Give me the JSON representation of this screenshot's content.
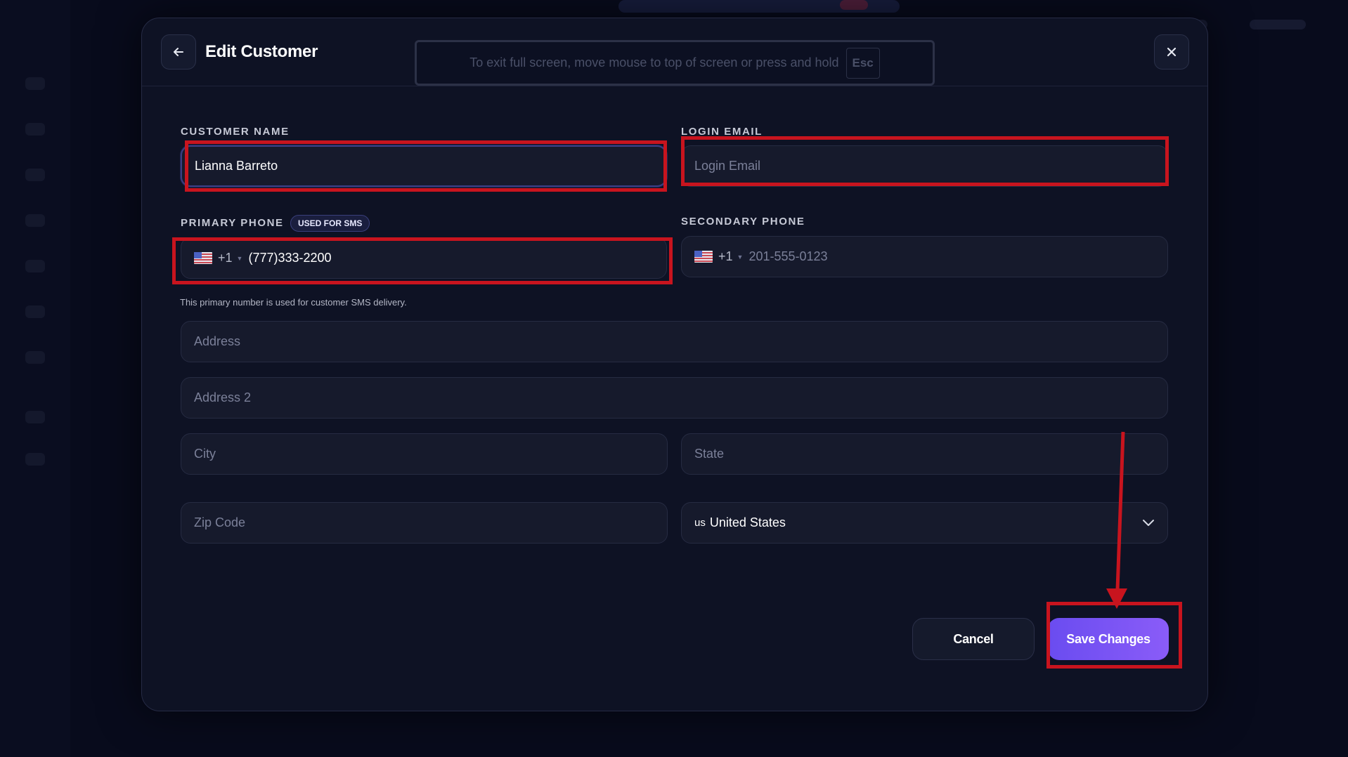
{
  "modal": {
    "title": "Edit Customer",
    "back_icon": "arrow-left-icon",
    "close_icon": "close-icon"
  },
  "fullscreen_notice": {
    "text": "To exit full screen, move mouse to top of screen or press and hold",
    "key": "Esc"
  },
  "form": {
    "customer_name": {
      "label": "CUSTOMER NAME",
      "value": "Lianna Barreto"
    },
    "login_email": {
      "label": "LOGIN EMAIL",
      "placeholder": "Login Email"
    },
    "primary_phone": {
      "label": "PRIMARY PHONE",
      "badge": "USED FOR SMS",
      "country_code": "+1",
      "value": "(777)333-2200",
      "helper": "This primary number is used for customer SMS delivery."
    },
    "secondary_phone": {
      "label": "SECONDARY PHONE",
      "country_code": "+1",
      "placeholder": "201-555-0123"
    },
    "address": {
      "placeholder": "Address"
    },
    "address2": {
      "placeholder": "Address 2"
    },
    "city": {
      "placeholder": "City"
    },
    "state": {
      "placeholder": "State"
    },
    "zip": {
      "placeholder": "Zip Code"
    },
    "country": {
      "code": "us",
      "value": "United States"
    }
  },
  "actions": {
    "cancel": "Cancel",
    "save": "Save Changes"
  },
  "colors": {
    "accent": "#7b55f5",
    "annotation": "#c8141e",
    "background": "#0e1224"
  }
}
